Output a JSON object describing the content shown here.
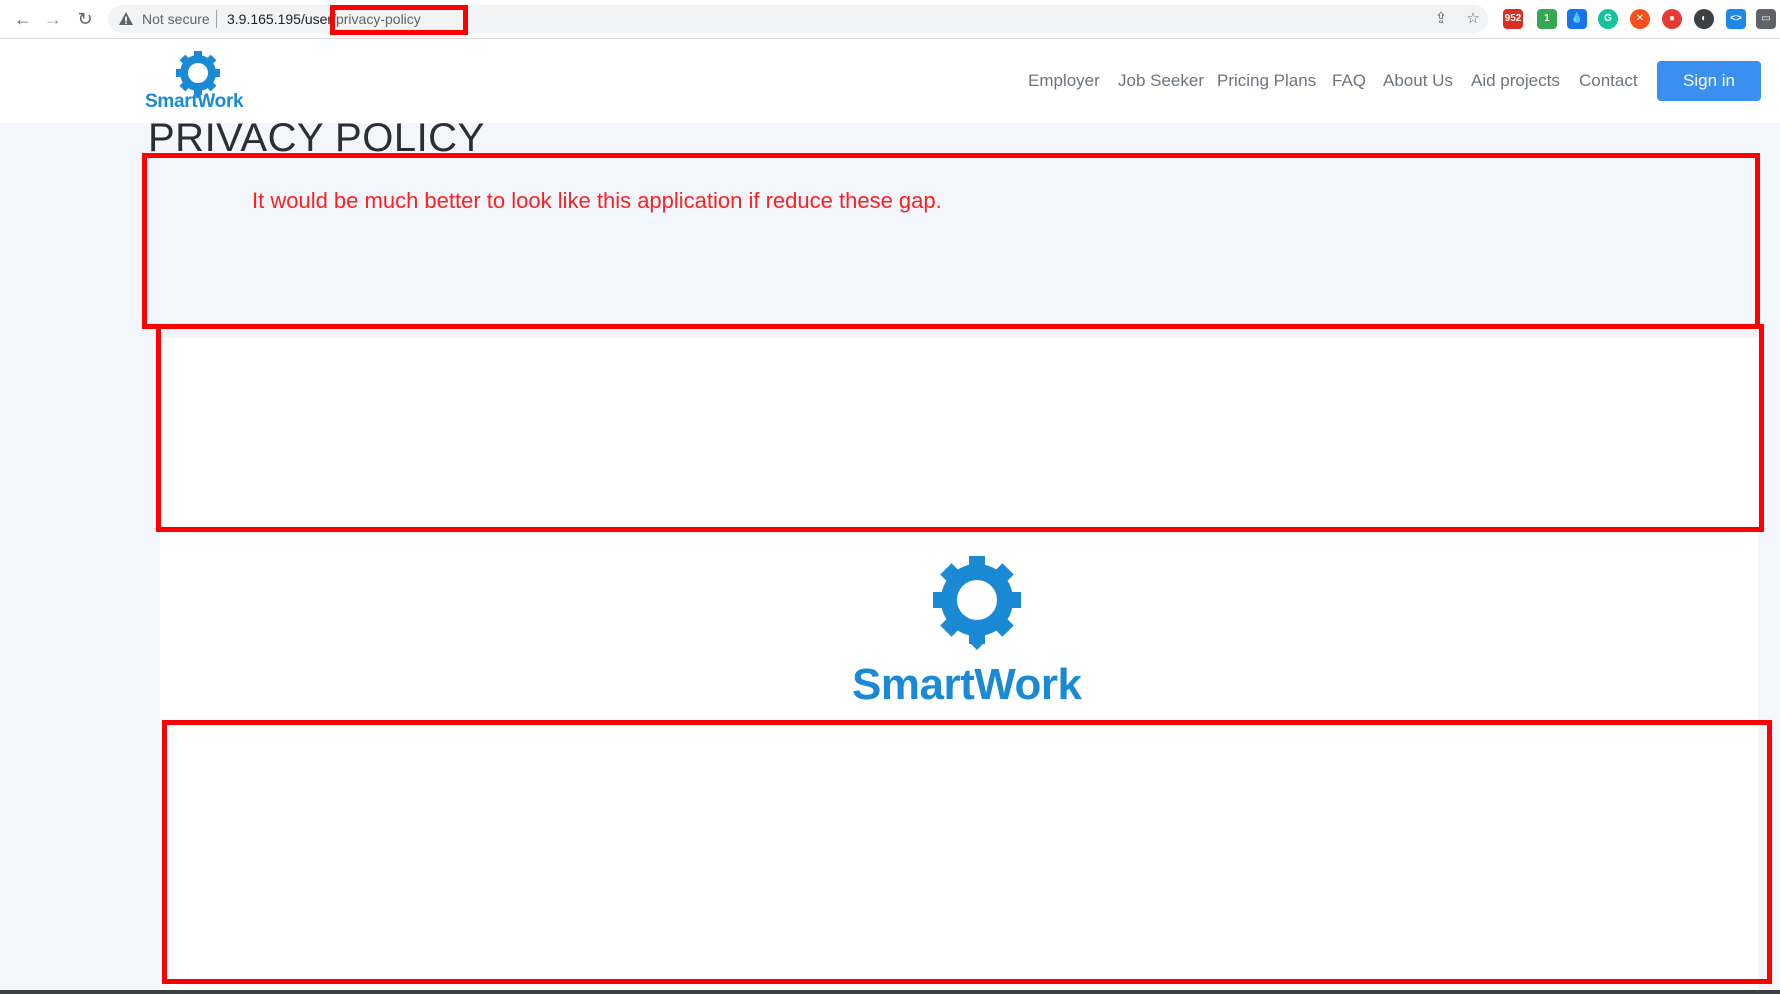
{
  "browser": {
    "back": "←",
    "forward": "→",
    "reload": "↻",
    "security_label": "Not secure",
    "url_host": "3.9.165.195/user",
    "url_path": "/privacy-policy",
    "share_icon": "⇪",
    "star_icon": "☆",
    "extensions": [
      {
        "name": "gmail",
        "label": "952",
        "color": "#d93025"
      },
      {
        "name": "shield",
        "label": "1",
        "color": "#34a853"
      },
      {
        "name": "drop",
        "label": "💧",
        "color": "#1a73e8"
      },
      {
        "name": "grammarly",
        "label": "G",
        "color": "#15c39a"
      },
      {
        "name": "x-ext",
        "label": "✕",
        "color": "#f4511e"
      },
      {
        "name": "rec",
        "label": "●",
        "color": "#e53935"
      },
      {
        "name": "mouse",
        "label": "◐",
        "color": "#3c4043"
      },
      {
        "name": "code",
        "label": "<>",
        "color": "#1e88e5"
      },
      {
        "name": "screen",
        "label": "▭",
        "color": "#5f6368"
      }
    ]
  },
  "header": {
    "logo_text": "SmartWork",
    "nav": [
      "Employer",
      "Job Seeker",
      "Pricing Plans",
      "FAQ",
      "About Us",
      "Aid projects",
      "Contact"
    ],
    "signin_label": "Sign in"
  },
  "page": {
    "title": "PRIVACY POLICY",
    "footer_logo_text": "SmartWork"
  },
  "annotation": {
    "note": "It would be much better to look like this application if reduce these gap.",
    "color": "#ff0000"
  },
  "colors": {
    "brand_blue": "#1a8ad4",
    "button_blue": "#3b8ff0",
    "page_bg": "#f3f6fc"
  }
}
